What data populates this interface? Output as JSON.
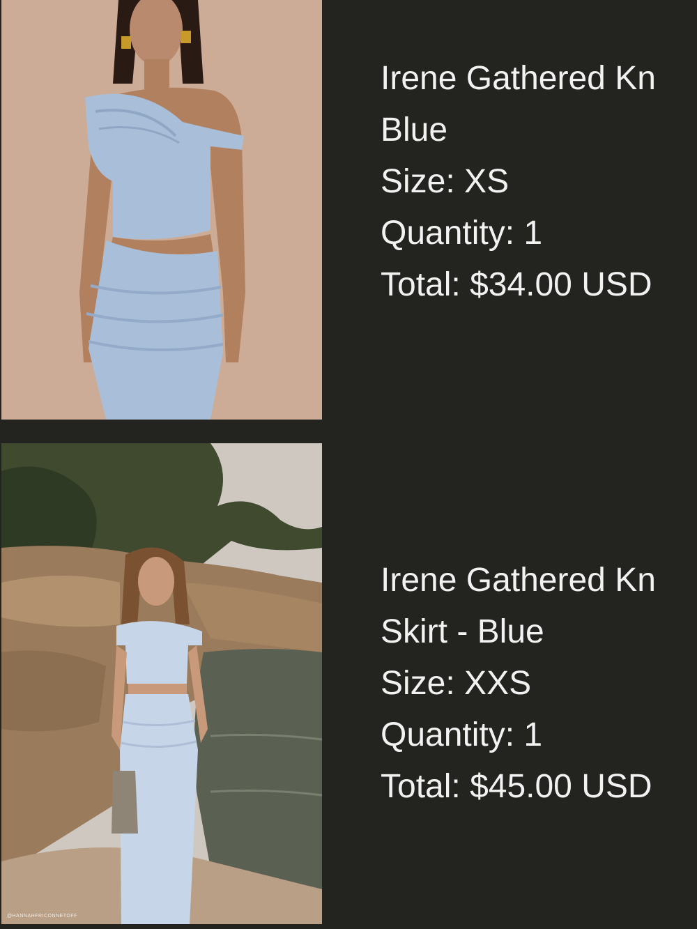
{
  "items": [
    {
      "title_line1": "Irene Gathered Kn",
      "title_line2": "Blue",
      "size": "Size: XS",
      "quantity": "Quantity: 1",
      "total": "Total: $34.00 USD"
    },
    {
      "title_line1": "Irene Gathered Kn",
      "title_line2": "Skirt - Blue",
      "size": "Size: XXS",
      "quantity": "Quantity: 1",
      "total": "Total: $45.00 USD",
      "photo_credit": "@HANNAHFRICONNETOFF"
    }
  ],
  "colors": {
    "background": "#23241f",
    "text": "#f2f2f2",
    "garment_blue": "#a9bfd9"
  }
}
